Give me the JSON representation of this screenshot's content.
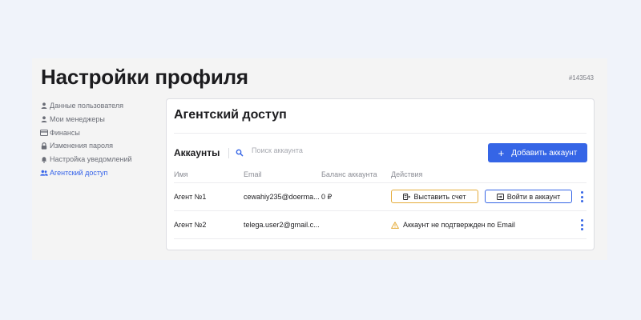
{
  "header": {
    "title": "Настройки профиля",
    "profile_id": "#143543"
  },
  "sidebar": {
    "items": [
      {
        "label": "Данные пользователя",
        "icon": "user-icon"
      },
      {
        "label": "Мои менеджеры",
        "icon": "user-icon"
      },
      {
        "label": "Финансы",
        "icon": "card-icon"
      },
      {
        "label": "Изменения пароля",
        "icon": "lock-icon"
      },
      {
        "label": "Настройка уведомлений",
        "icon": "bell-icon"
      },
      {
        "label": "Агентский доступ",
        "icon": "users-icon",
        "active": true
      }
    ]
  },
  "main": {
    "title": "Агентский доступ",
    "accounts_label": "Аккаунты",
    "search": {
      "placeholder": "Поиск аккаунта",
      "value": ""
    },
    "add_button": "Добавить аккаунт",
    "table": {
      "columns": [
        "Имя",
        "Email",
        "Баланс аккаунта",
        "Действия"
      ],
      "rows": [
        {
          "name": "Агент №1",
          "email": "cewahiy235@doerma...",
          "balance": "0 ₽",
          "actions": {
            "invoice": "Выставить счет",
            "login": "Войти в аккаунт"
          }
        },
        {
          "name": "Агент №2",
          "email": "telega.user2@gmail.c...",
          "balance": "",
          "warning": "Аккаунт не подтвержден по Email"
        }
      ]
    }
  },
  "colors": {
    "accent": "#3565e6",
    "warning": "#e5ac3a",
    "background": "#f0f3fa"
  }
}
